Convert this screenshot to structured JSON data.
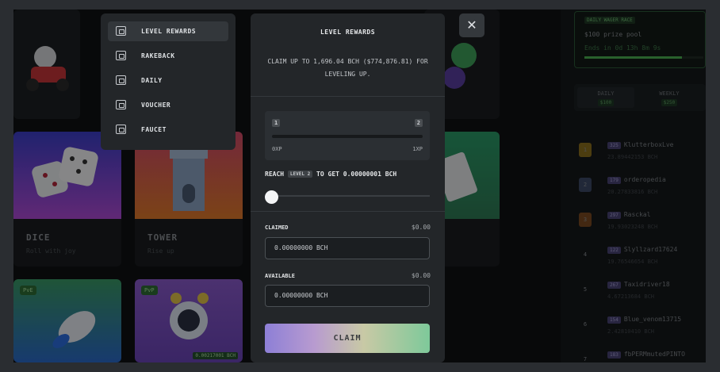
{
  "colors": {
    "accent_green": "#4caf50",
    "modal_bg": "#232629",
    "claim_gradient": [
      "#8d7fd6",
      "#c8c9a5",
      "#7ec99a"
    ]
  },
  "menu": {
    "items": [
      {
        "label": "LEVEL REWARDS",
        "icon": "level-rewards-icon",
        "active": true
      },
      {
        "label": "RAKEBACK",
        "icon": "rakeback-icon"
      },
      {
        "label": "DAILY",
        "icon": "daily-icon"
      },
      {
        "label": "VOUCHER",
        "icon": "voucher-icon"
      },
      {
        "label": "FAUCET",
        "icon": "faucet-icon"
      }
    ]
  },
  "modal": {
    "title": "LEVEL REWARDS",
    "description": "CLAIM UP TO 1,696.04 BCH ($774,876.81) FOR LEVELING UP.",
    "xp": {
      "level_from": "1",
      "level_to": "2",
      "xp_from": "0XP",
      "xp_to": "1XP",
      "progress": 0
    },
    "reach": {
      "prefix": "REACH",
      "level": "LEVEL 2",
      "suffix": "TO GET 0.00000001 BCH"
    },
    "slider_value": 0,
    "claimed": {
      "label": "CLAIMED",
      "usd": "$0.00",
      "value": "0.00000000 BCH"
    },
    "available": {
      "label": "AVAILABLE",
      "usd": "$0.00",
      "value": "0.00000000 BCH"
    },
    "claim_button": "CLAIM",
    "close_icon": "close-icon"
  },
  "games": {
    "dice": {
      "title": "DICE",
      "sub": "Roll with joy"
    },
    "tower": {
      "title": "TOWER",
      "sub": "Rise up"
    },
    "pvp1": {
      "badge": "PvE"
    },
    "pvp2": {
      "badge": "PvP",
      "amount": "0.00217001 BCH"
    }
  },
  "race": {
    "tag": "DAILY WAGER RACE",
    "prize": "$100 prize pool",
    "ends": "Ends in 0d 13h 8m 9s",
    "progress": 0.82
  },
  "leaderboard_tabs": [
    {
      "label": "DAILY",
      "badge": "$100"
    },
    {
      "label": "WEEKLY",
      "badge": "$250"
    }
  ],
  "leaderboard": [
    {
      "rank": "1",
      "level": "325",
      "name": "KlutterboxLve",
      "amount": "23.89442153 BCH"
    },
    {
      "rank": "2",
      "level": "179",
      "name": "orderopedia",
      "amount": "20.27833816 BCH"
    },
    {
      "rank": "3",
      "level": "297",
      "name": "Rasckal",
      "amount": "19.93023248 BCH"
    },
    {
      "rank": "4",
      "level": "122",
      "name": "Slyllzard17624",
      "amount": "19.76546654 BCH"
    },
    {
      "rank": "5",
      "level": "267",
      "name": "Taxidriver18",
      "amount": "4.67213684 BCH"
    },
    {
      "rank": "6",
      "level": "154",
      "name": "Blue_venom13715",
      "amount": "2.42810410 BCH"
    },
    {
      "rank": "7",
      "level": "183",
      "name": "fbPERMmutedPINTO",
      "amount": ""
    }
  ]
}
